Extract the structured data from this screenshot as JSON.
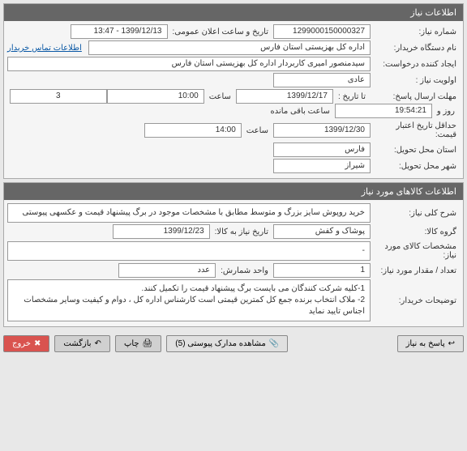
{
  "panel1": {
    "title": "اطلاعات نیاز",
    "need_number_label": "شماره نیاز:",
    "need_number": "1299000150000327",
    "public_date_label": "تاریخ و ساعت اعلان عمومی:",
    "public_date": "1399/12/13 - 13:47",
    "org_label": "نام دستگاه خریدار:",
    "org": "اداره کل بهزیستی استان فارس",
    "contact_link": "اطلاعات تماس خریدار",
    "creator_label": "ایجاد کننده درخواست:",
    "creator": "سیدمنصور امیری کاربردار اداره کل بهزیستی استان فارس",
    "priority_label": "اولویت نیاز :",
    "priority": "عادی",
    "deadline_label": "مهلت ارسال پاسخ:",
    "until_date_label": "تا تاریخ :",
    "until_date": "1399/12/17",
    "hour_label": "ساعت",
    "until_time": "10:00",
    "days_value": "3",
    "days_label": "روز و",
    "remaining_time": "19:54:21",
    "remaining_label": "ساعت باقی مانده",
    "min_valid_label": "حداقل تاریخ اعتبار قیمت:",
    "min_valid_date": "1399/12/30",
    "min_valid_time": "14:00",
    "province_label": "استان محل تحویل:",
    "province": "فارس",
    "city_label": "شهر محل تحویل:",
    "city": "شیراز"
  },
  "panel2": {
    "title": "اطلاعات کالاهای مورد نیاز",
    "summary_label": "شرح کلی نیاز:",
    "summary": "خرید روپوش سایز بزرگ و متوسط مطابق با مشخصات موجود در برگ پیشنهاد قیمت و عکسهی پیوستی",
    "group_label": "گروه کالا:",
    "group": "پوشاک و کفش",
    "need_by_label": "تاریخ نیاز به کالا:",
    "need_by": "1399/12/23",
    "spec_label": "مشخصات کالای مورد نیاز:",
    "spec": "-",
    "qty_label": "تعداد / مقدار مورد نیاز:",
    "qty": "1",
    "unit_label": "واحد شمارش:",
    "unit": "عدد",
    "notes_label": "توضیحات خریدار:",
    "notes": "1-کلیه شرکت کنندگان می بایست برگ پیشنهاد قیمت را تکمیل کنند.\n2- ملاک انتخاب برنده جمع کل کمترین قیمتی است کارشناس اداره کل  ، دوام و کیفیت وسایر مشخصات  اجناس تایید نماید"
  },
  "buttons": {
    "respond": "پاسخ به نیاز",
    "attachments": "مشاهده مدارک پیوستی (5)",
    "print": "چاپ",
    "back": "بازگشت",
    "exit": "خروج"
  }
}
